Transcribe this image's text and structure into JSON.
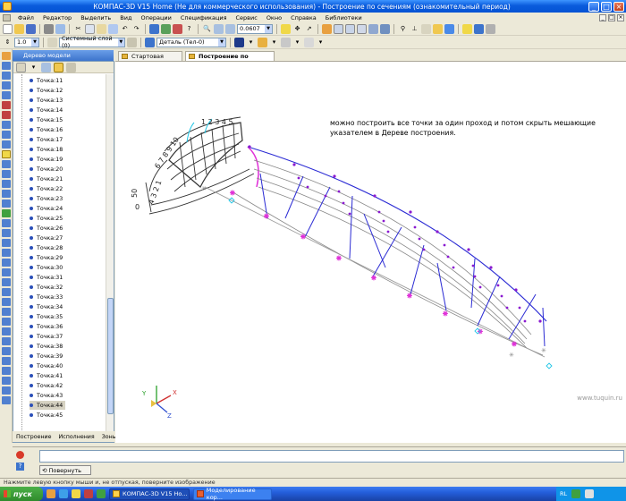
{
  "window": {
    "title": "КОМПАС-3D V15 Home (Не для коммерческого использования) - Построение по сечениям (ознакомительный период)"
  },
  "menu": [
    "Файл",
    "Редактор",
    "Выделить",
    "Вид",
    "Операции",
    "Спецификация",
    "Сервис",
    "Окно",
    "Справка",
    "Библиотеки"
  ],
  "toolbar": {
    "zoom_value": "0.0607",
    "scale_value": "1.0",
    "coord_system": "Системный слой (0)",
    "detail_combo": "Деталь (Тел-0)"
  },
  "tree_panel": {
    "caption": "Дерево модели",
    "items": [
      "Точка:11",
      "Точка:12",
      "Точка:13",
      "Точка:14",
      "Точка:15",
      "Точка:16",
      "Точка:17",
      "Точка:18",
      "Точка:19",
      "Точка:20",
      "Точка:21",
      "Точка:22",
      "Точка:23",
      "Точка:24",
      "Точка:25",
      "Точка:26",
      "Точка:27",
      "Точка:28",
      "Точка:29",
      "Точка:30",
      "Точка:31",
      "Точка:32",
      "Точка:33",
      "Точка:34",
      "Точка:35",
      "Точка:36",
      "Точка:37",
      "Точка:38",
      "Точка:39",
      "Точка:40",
      "Точка:41",
      "Точка:42",
      "Точка:43",
      "Точка:44",
      "Точка:45"
    ],
    "selected_item": "Точка:44",
    "bottom_tabs": [
      "Построение",
      "Исполнения",
      "Зоны"
    ]
  },
  "tabs": {
    "start_page": "Стартовая страница",
    "active": "Построение по сечениям",
    "close": "×"
  },
  "canvas": {
    "note": "можно построить все точки за один проход и потом скрыть мешающие указателем в Дереве построения.",
    "sketch_numbers_top": "1 2 3 4 5",
    "sketch_numbers_left": "6 7 8 9 10",
    "sketch_numbers_side": "4 3 2 1",
    "sketch_label_50": "50",
    "sketch_label_0": "0",
    "axis_x": "X",
    "axis_y": "Y",
    "axis_z": "Z",
    "watermark": "www.tuquin.ru"
  },
  "bottom": {
    "rotate_label": "Повернуть"
  },
  "status": {
    "hint": "Нажмите левую кнопку мыши и, не отпуская, поверните изображение"
  },
  "taskbar": {
    "start": "пуск",
    "task1": "КОМПАС-3D V15 Ho...",
    "task2": "Моделирование кор...",
    "lang": "RL"
  },
  "colors": {
    "guide_blue": "#2b2bd4",
    "point_purple": "#8a1ad0",
    "section_magenta": "#e032d8",
    "cyan_marker": "#22c6e6"
  }
}
